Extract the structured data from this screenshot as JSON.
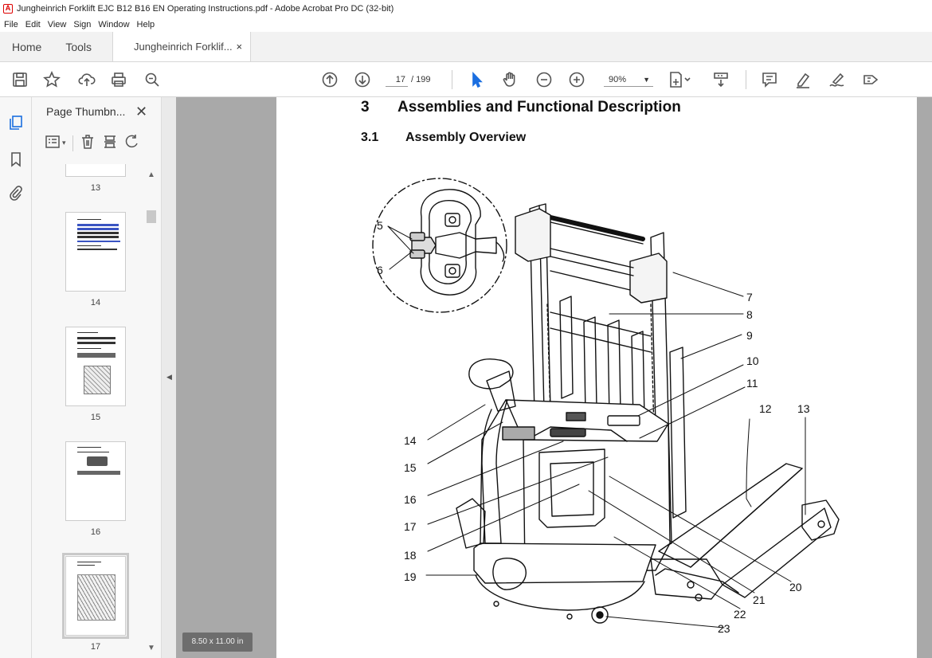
{
  "window": {
    "title": "Jungheinrich Forklift EJC B12 B16 EN Operating Instructions.pdf - Adobe Acrobat Pro DC (32-bit)"
  },
  "menu": [
    "File",
    "Edit",
    "View",
    "Sign",
    "Window",
    "Help"
  ],
  "tabs": {
    "home": "Home",
    "tools": "Tools",
    "document": "Jungheinrich Forklif...",
    "close": "×"
  },
  "toolbar": {
    "current_page": "17",
    "total_pages": "/ 199",
    "zoom": "90%"
  },
  "sidebar": {
    "panel_title": "Page Thumbn...",
    "thumbnails": [
      {
        "label": "13"
      },
      {
        "label": "14"
      },
      {
        "label": "15"
      },
      {
        "label": "16"
      },
      {
        "label": "17",
        "selected": true
      }
    ]
  },
  "page_size_badge": "8.50 x 11.00 in",
  "document": {
    "chapter_number": "3",
    "chapter_title": "Assemblies and Functional Description",
    "section_number": "3.1",
    "section_title": "Assembly Overview",
    "callouts": [
      "5",
      "6",
      "7",
      "8",
      "9",
      "10",
      "11",
      "12",
      "13",
      "14",
      "15",
      "16",
      "17",
      "18",
      "19",
      "20",
      "21",
      "22",
      "23"
    ]
  },
  "colors": {
    "accent": "#1a6ee0",
    "workspace": "#a9a9a9",
    "acrobat_red": "#d00000"
  }
}
